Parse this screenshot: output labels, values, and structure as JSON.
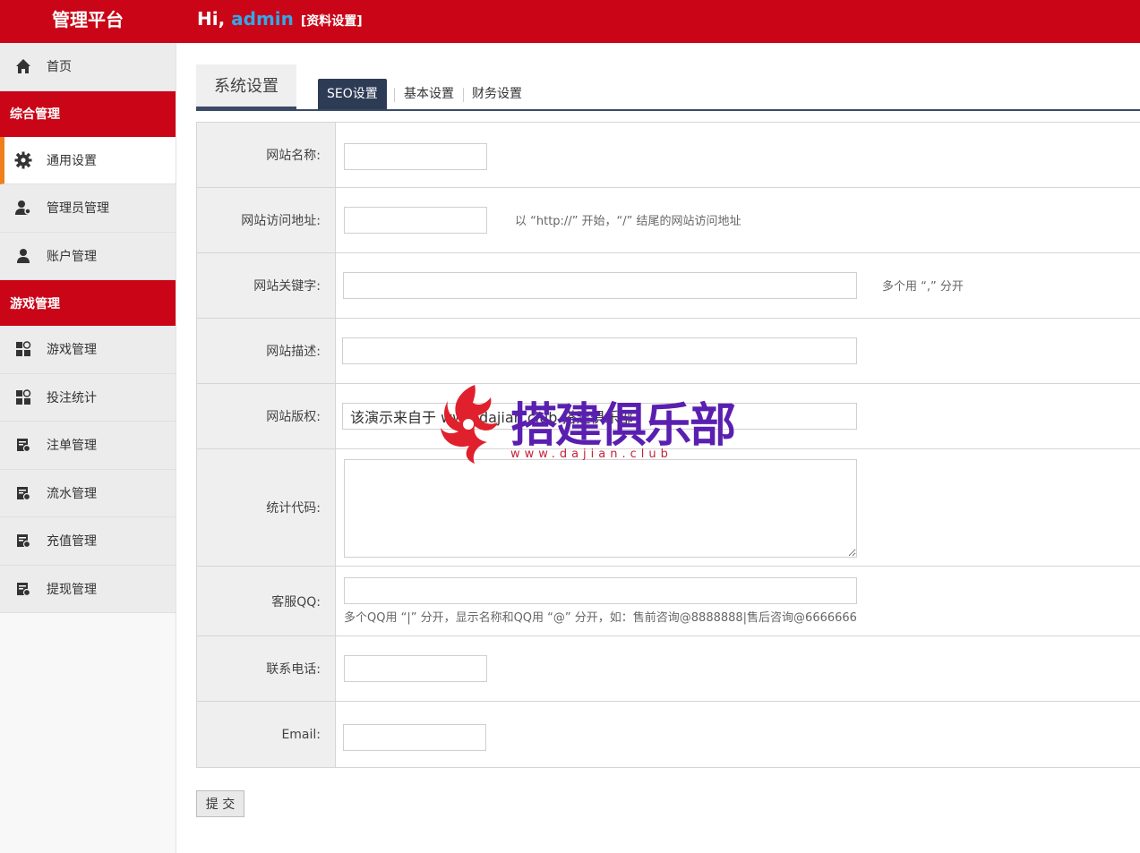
{
  "header": {
    "brand": "管理平台",
    "greeting": "Hi, ",
    "username": "admin",
    "profile_link": "[资料设置]"
  },
  "sidebar": {
    "items": [
      {
        "label": "首页",
        "icon": "home-icon"
      },
      {
        "group": "综合管理"
      },
      {
        "label": "通用设置",
        "icon": "gear-icon",
        "active": true
      },
      {
        "label": "管理员管理",
        "icon": "admin-user-icon"
      },
      {
        "label": "账户管理",
        "icon": "user-icon"
      },
      {
        "group": "游戏管理"
      },
      {
        "label": "游戏管理",
        "icon": "grid-icon"
      },
      {
        "label": "投注统计",
        "icon": "grid-icon"
      },
      {
        "label": "注单管理",
        "icon": "document-icon"
      },
      {
        "label": "流水管理",
        "icon": "document-icon"
      },
      {
        "label": "充值管理",
        "icon": "document-icon"
      },
      {
        "label": "提现管理",
        "icon": "document-icon"
      }
    ]
  },
  "tabs": {
    "title": "系统设置",
    "items": [
      {
        "label": "SEO设置",
        "active": true
      },
      {
        "label": "基本设置"
      },
      {
        "label": "财务设置"
      }
    ]
  },
  "form": {
    "site_name": {
      "label": "网站名称:",
      "value": ""
    },
    "site_url": {
      "label": "网站访问地址:",
      "value": "",
      "hint": "以 “http://” 开始，“/” 结尾的网站访问地址"
    },
    "keywords": {
      "label": "网站关键字:",
      "value": "",
      "hint": "多个用 “,” 分开"
    },
    "description": {
      "label": "网站描述:",
      "value": ""
    },
    "copyright": {
      "label": "网站版权:",
      "value": "该演示来自于 www.dajian.club 搭建俱乐部"
    },
    "stats_code": {
      "label": "统计代码:",
      "value": ""
    },
    "qq": {
      "label": "客服QQ:",
      "value": "",
      "hint": "多个QQ用 “|” 分开，显示名称和QQ用 “@” 分开，如：售前咨询@8888888|售后咨询@6666666"
    },
    "phone": {
      "label": "联系电话:",
      "value": ""
    },
    "email": {
      "label": "Email:",
      "value": ""
    }
  },
  "submit_label": "提 交",
  "watermark": {
    "title": "搭建俱乐部",
    "url": "www.dajian.club"
  },
  "colors": {
    "header_red": "#c90517",
    "active_accent": "#ef7f1a",
    "tab_navy": "#2e3b55",
    "username_blue": "#33a7e8"
  }
}
